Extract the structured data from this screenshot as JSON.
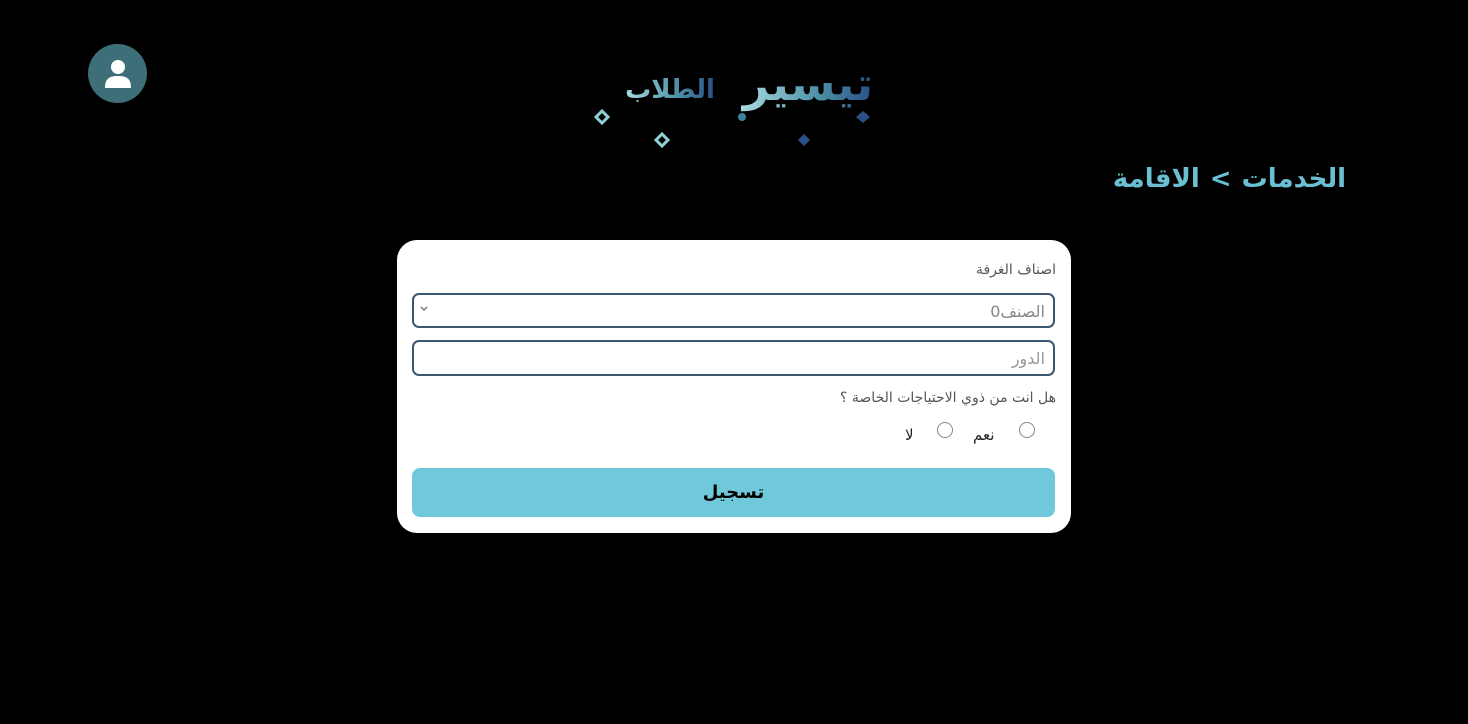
{
  "header": {
    "logo_text": "تيسير الطلاب",
    "avatar_icon": "user-icon"
  },
  "breadcrumb": {
    "parent": "الخدمات",
    "separator": ">",
    "current": "الاقامة"
  },
  "form": {
    "room_type_label": "اصناف الغرفة",
    "room_type_selected": "الصنف0",
    "floor_placeholder": "الدور",
    "special_needs_question": "هل انت من ذوي الاحتياجات الخاصة ؟",
    "option_yes": "نعم",
    "option_no": "لا",
    "submit_label": "تسجيل"
  },
  "colors": {
    "background": "#000000",
    "accent": "#6bbfd3",
    "button": "#6fc9da",
    "avatar": "#3e6e78",
    "input_border": "#3a5670"
  }
}
